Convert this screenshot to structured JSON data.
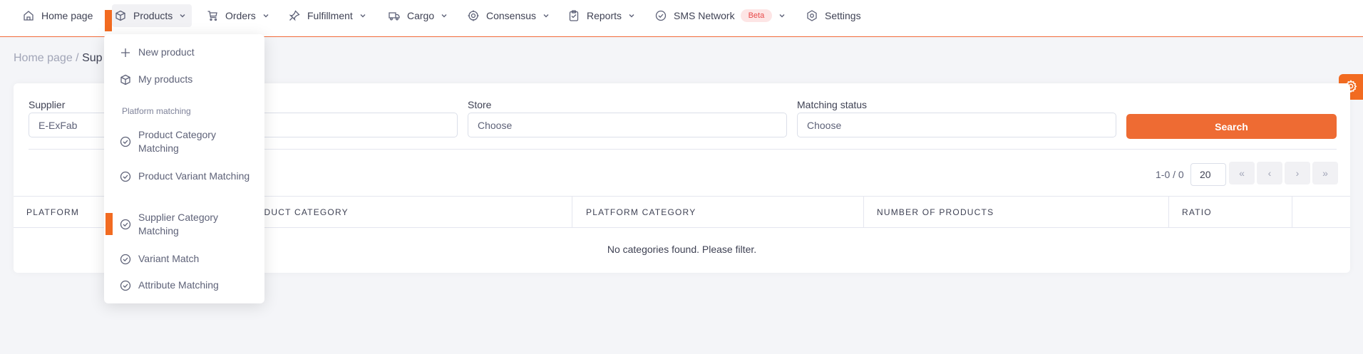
{
  "nav": {
    "items": [
      {
        "label": "Home page",
        "icon": "home-icon"
      },
      {
        "label": "Products",
        "icon": "box-icon"
      },
      {
        "label": "Orders",
        "icon": "cart-icon"
      },
      {
        "label": "Fulfillment",
        "icon": "pin-icon"
      },
      {
        "label": "Cargo",
        "icon": "truck-icon"
      },
      {
        "label": "Consensus",
        "icon": "target-icon"
      },
      {
        "label": "Reports",
        "icon": "clipboard-icon"
      },
      {
        "label": "SMS Network",
        "icon": "check-circle-icon",
        "badge": "Beta"
      },
      {
        "label": "Settings",
        "icon": "gear-icon"
      }
    ]
  },
  "breadcrumb": {
    "home": "Home page",
    "separator": "/",
    "current": "Sup"
  },
  "filters": {
    "supplier_label": "Supplier",
    "supplier_value": "E-ExFab",
    "store_label": "Store",
    "store_placeholder": "Choose",
    "matching_status_label": "Matching status",
    "matching_status_placeholder": "Choose",
    "search_button": "Search"
  },
  "pagination": {
    "info": "1-0 / 0",
    "page_size": "20",
    "first": "«",
    "prev": "‹",
    "next": "›",
    "last": "»"
  },
  "table": {
    "columns": [
      "PLATFORM",
      "ODUCT CATEGORY",
      "PLATFORM CATEGORY",
      "NUMBER OF PRODUCTS",
      "RATIO"
    ],
    "empty_message": "No categories found. Please filter."
  },
  "products_menu": {
    "items": [
      {
        "label": "New product",
        "icon": "plus-icon"
      },
      {
        "label": "My products",
        "icon": "box-icon"
      }
    ],
    "section_title": "Platform matching",
    "matching_items": [
      {
        "label": "Product Category Matching",
        "icon": "check-circle-icon"
      },
      {
        "label": "Product Variant Matching",
        "icon": "check-circle-icon"
      },
      {
        "label": "Supplier Category Matching",
        "icon": "check-circle-icon"
      },
      {
        "label": "Variant Match",
        "icon": "check-circle-icon"
      },
      {
        "label": "Attribute Matching",
        "icon": "check-circle-icon"
      }
    ]
  },
  "colors": {
    "accent": "#ee6b33",
    "marker": "#f26b21",
    "beta_bg": "#fde5e5",
    "beta_text": "#e84a4a"
  }
}
